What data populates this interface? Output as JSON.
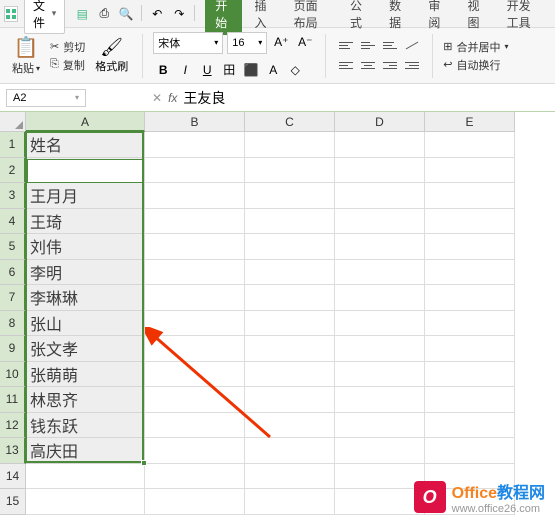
{
  "menubar": {
    "file_label": "文件",
    "tabs": [
      "开始",
      "插入",
      "页面布局",
      "公式",
      "数据",
      "审阅",
      "视图",
      "开发工具"
    ],
    "active_tab_index": 0
  },
  "ribbon": {
    "paste_label": "粘贴",
    "cut_label": "剪切",
    "copy_label": "复制",
    "format_brush_label": "格式刷",
    "font_name": "宋体",
    "font_size": "16",
    "merge_label": "合并居中",
    "wrap_label": "自动换行"
  },
  "formula_bar": {
    "name_box": "A2",
    "formula": "王友良"
  },
  "columns": [
    "A",
    "B",
    "C",
    "D",
    "E"
  ],
  "rows": [
    "1",
    "2",
    "3",
    "4",
    "5",
    "6",
    "7",
    "8",
    "9",
    "10",
    "11",
    "12",
    "13",
    "14",
    "15"
  ],
  "chart_data": {
    "type": "table",
    "header": "姓名",
    "values": [
      "王友良",
      "王月月",
      "王琦",
      "刘伟",
      "李明",
      "李琳琳",
      "张山",
      "张文孝",
      "张萌萌",
      "林思齐",
      "钱东跃",
      "高庆田"
    ]
  },
  "selection": {
    "active_cell": "A2",
    "range_start": "A1",
    "range_end": "A13"
  },
  "watermark": {
    "brand_prefix": "Office",
    "brand_suffix": "教程网",
    "url": "www.office26.com",
    "logo_letter": "O"
  }
}
